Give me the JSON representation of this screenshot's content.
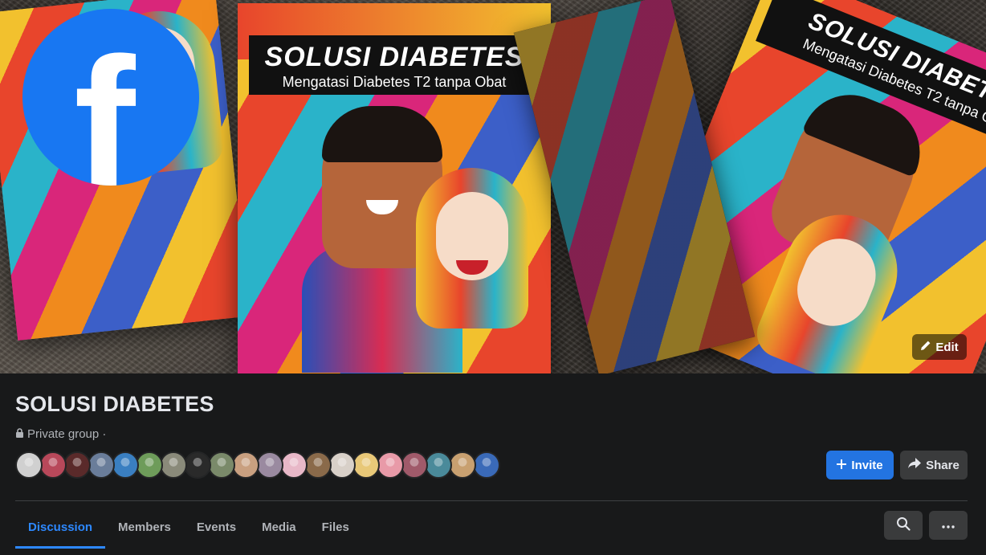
{
  "cover": {
    "book_title": "SOLUSI DIABETES",
    "book_subtitle": "Mengatasi Diabetes T2 tanpa Obat",
    "edit_label": "Edit"
  },
  "logo": {
    "glyph": "f",
    "color": "#1877f2"
  },
  "group": {
    "name": "SOLUSI DIABETES",
    "privacy": "Private group ·",
    "member_avatar_colors": [
      "#d0d0d0",
      "#b8485a",
      "#5a2a2a",
      "#6a7d9a",
      "#3a7fc1",
      "#6e9c5a",
      "#8a8a7a",
      "#2a2a2a",
      "#7a8a6a",
      "#c9a080",
      "#9a8aa0",
      "#e8b8c8",
      "#8a6a4a",
      "#d8d0c8",
      "#e8c878",
      "#e89aa8",
      "#a05a6a",
      "#4a8a9a",
      "#c8a070",
      "#3a6ab8"
    ]
  },
  "actions": {
    "invite_label": "Invite",
    "share_label": "Share"
  },
  "tabs": [
    {
      "label": "Discussion",
      "active": true
    },
    {
      "label": "Members",
      "active": false
    },
    {
      "label": "Events",
      "active": false
    },
    {
      "label": "Media",
      "active": false
    },
    {
      "label": "Files",
      "active": false
    }
  ],
  "icons": {
    "search": "search-icon",
    "more": "more-icon",
    "lock": "lock-icon",
    "plus": "plus-icon",
    "share": "share-arrow-icon",
    "pencil": "pencil-icon"
  },
  "accent": "#2d88ff"
}
